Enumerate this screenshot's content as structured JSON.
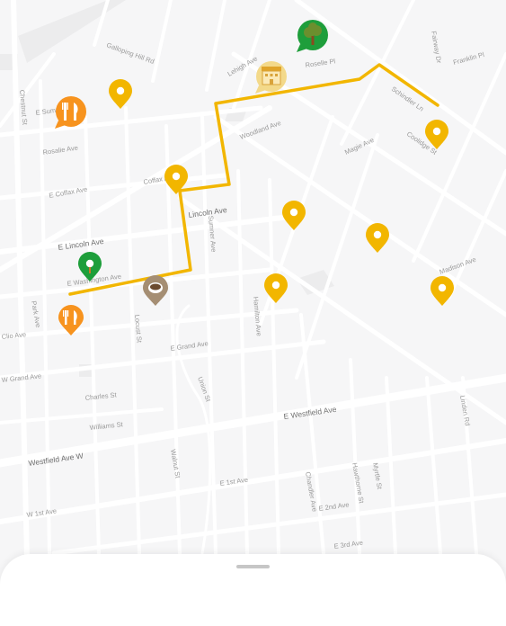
{
  "map": {
    "background_color": "#f6f6f7",
    "street_color": "#ffffff",
    "block_color": "#ececed",
    "route_color": "#f2b600",
    "street_labels": [
      "Galloping Hill Rd",
      "Chestnut St",
      "E Summit St",
      "Rosalie Ave",
      "E Coffax Ave",
      "Coffax Ave",
      "E Lincoln Ave",
      "Lincoln Ave",
      "E Washington Ave",
      "Clio Ave",
      "E Grand Ave",
      "W Grand Ave",
      "Charles St",
      "Williams St",
      "Westfield Ave W",
      "E Westfield Ave",
      "E 1st Ave",
      "W 1st Ave",
      "E 2nd Ave",
      "E 3rd Ave",
      "Lehigh Ave",
      "Magie Ave",
      "Chandler Ave",
      "Linden Rd",
      "Fairway Dr",
      "Madison Ave",
      "Woodland Ave",
      "Sumner Ave",
      "Hamilton Ave",
      "Schindler Ln",
      "Coolidge St",
      "Locust St",
      "Union St",
      "Myrtle St",
      "Hawthorne St",
      "Park Ave",
      "Walnut St",
      "Franklin Pl",
      "Roselle Pl"
    ],
    "pois": [
      {
        "icon": "restaurant-icon",
        "color": "#f7931e"
      },
      {
        "icon": "restaurant-icon",
        "color": "#f7931e"
      },
      {
        "icon": "park-tree-icon",
        "color": "#1e9e3b"
      },
      {
        "icon": "park-tree-icon",
        "color": "#1e9e3b"
      },
      {
        "icon": "hotel-icon",
        "color": "#f3d98a"
      },
      {
        "icon": "cafe-icon",
        "color": "#a58e73"
      },
      {
        "icon": "location-pin-icon",
        "color": "#f2b600"
      },
      {
        "icon": "location-pin-icon",
        "color": "#f2b600"
      },
      {
        "icon": "location-pin-icon",
        "color": "#f2b600"
      },
      {
        "icon": "location-pin-icon",
        "color": "#f2b600"
      },
      {
        "icon": "location-pin-icon",
        "color": "#f2b600"
      },
      {
        "icon": "location-pin-icon",
        "color": "#f2b600"
      },
      {
        "icon": "location-pin-icon",
        "color": "#f2b600"
      }
    ]
  },
  "sheet": {
    "handle_icon": "drag-handle-icon"
  }
}
